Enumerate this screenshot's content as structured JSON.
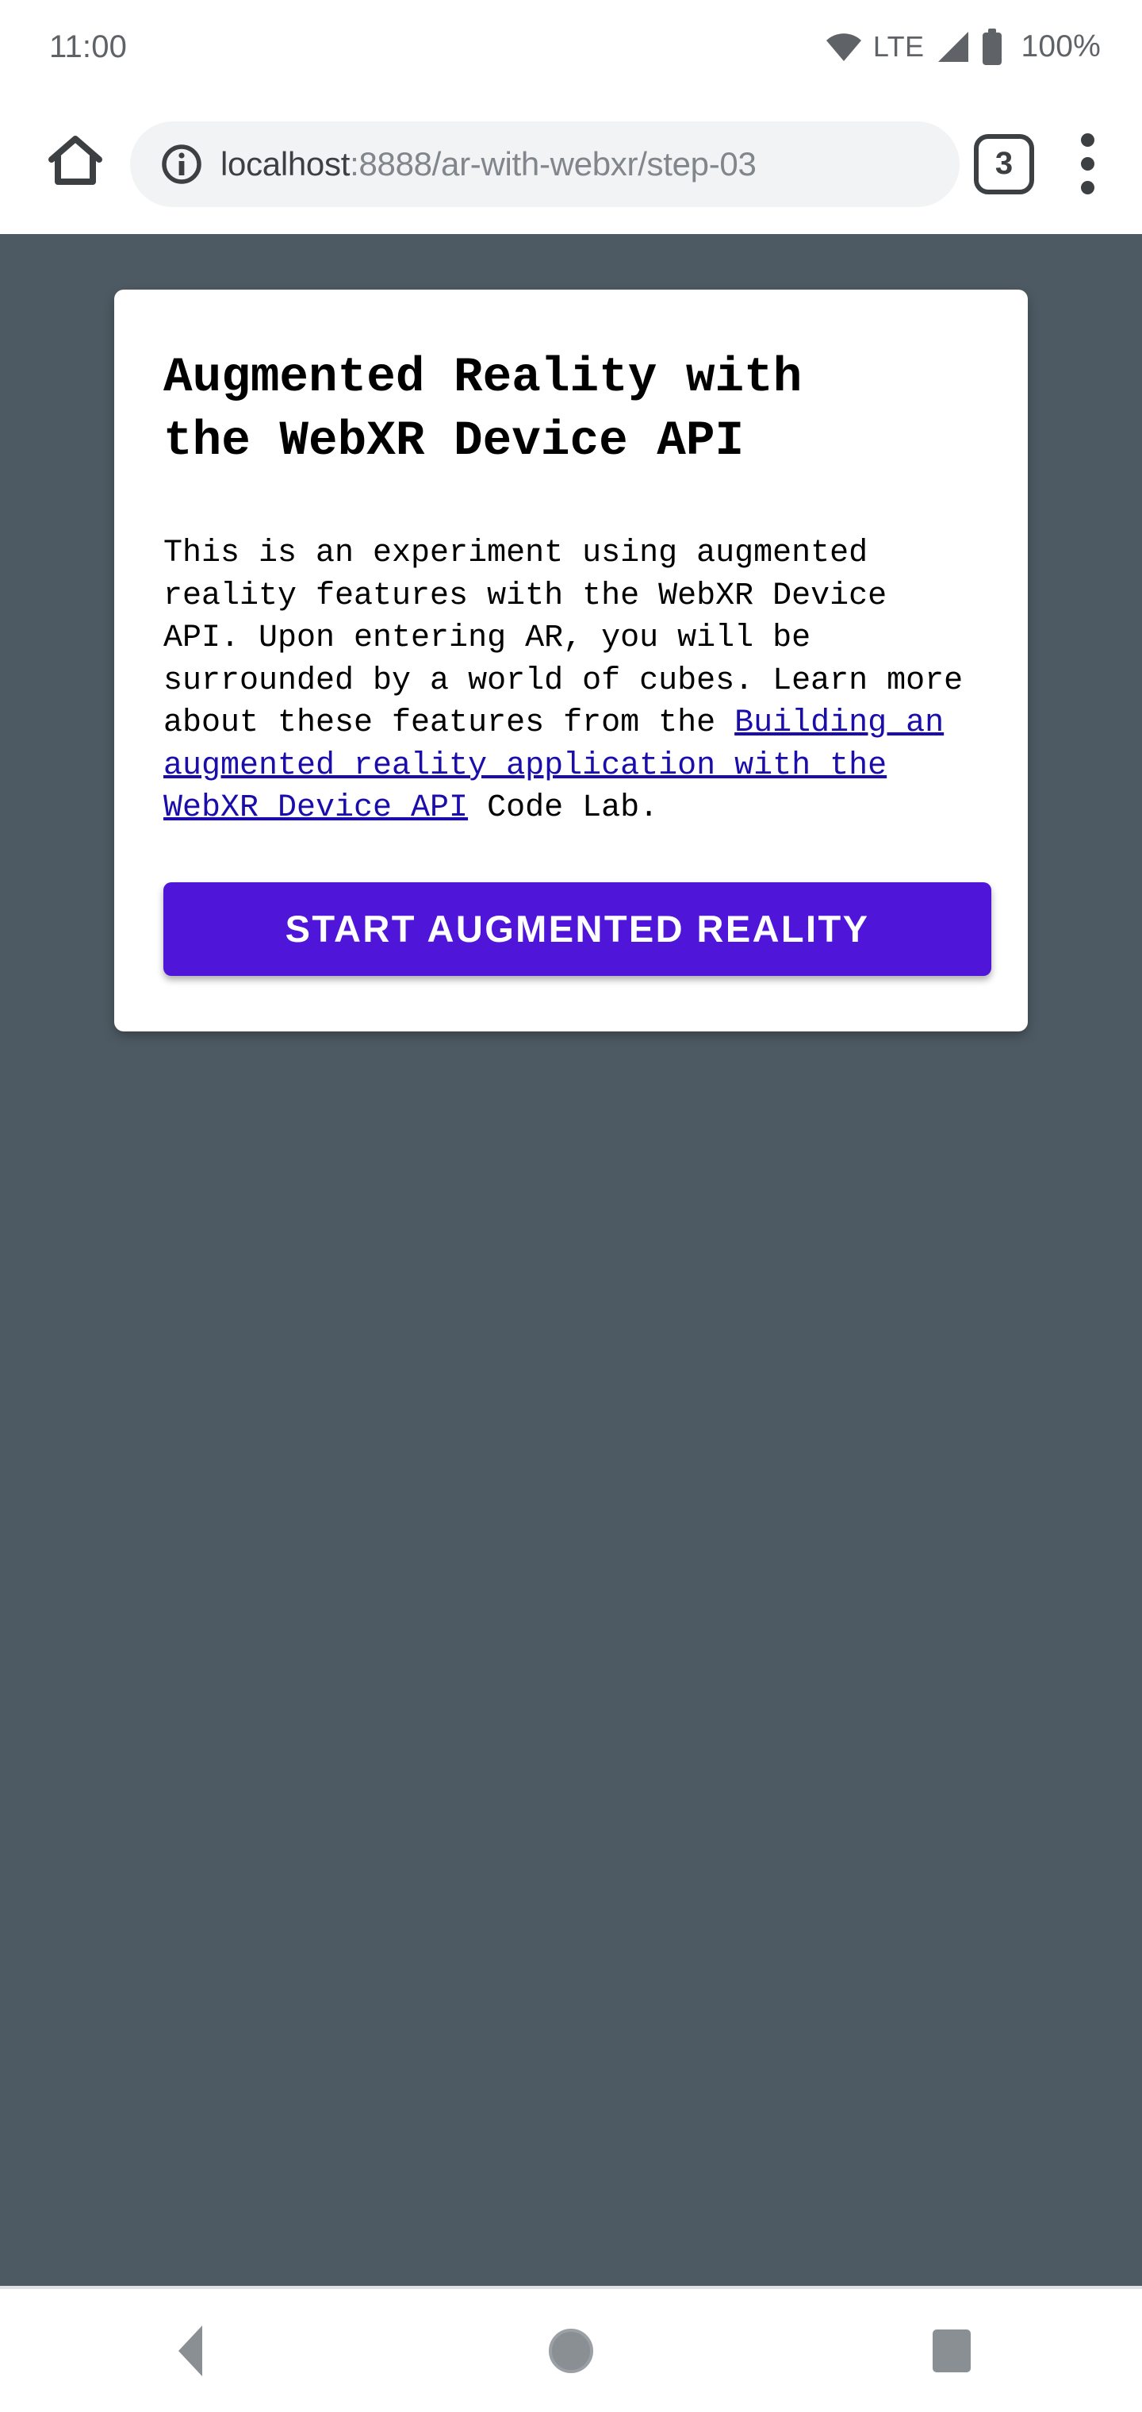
{
  "status_bar": {
    "clock": "11:00",
    "network_label": "LTE",
    "battery_percent": "100%",
    "icons": [
      "wifi-icon",
      "signal-icon",
      "battery-icon"
    ]
  },
  "browser": {
    "home_icon": "home-icon",
    "security_icon": "info-icon",
    "url_prefix": "localhost",
    "url_suffix": ":8888/ar-with-webxr/step-03",
    "url_full": "localhost:8888/ar-with-webxr/step-03",
    "tab_count": "3",
    "menu_icon": "overflow-menu-icon"
  },
  "content": {
    "background_color": "#4e5a63",
    "card": {
      "background_color": "#ffffff",
      "title": "Augmented Reality with\nthe WebXR Device API",
      "paragraph_part1": "This is an experiment using augmented reality features with the WebXR Device API. Upon entering AR, you will be surrounded by a world of cubes. Learn more about these features from the ",
      "link_text": "Building an augmented reality application with the WebXR Device API",
      "link_color": "#1a0dab",
      "paragraph_part2": " Code Lab.",
      "button_label": "START AUGMENTED REALITY",
      "button_color": "#4f16d9",
      "button_text_color": "#ffffff"
    }
  },
  "navigation_bar": {
    "back_label": "back-button",
    "home_label": "home-button",
    "recents_label": "recent-apps-button"
  }
}
